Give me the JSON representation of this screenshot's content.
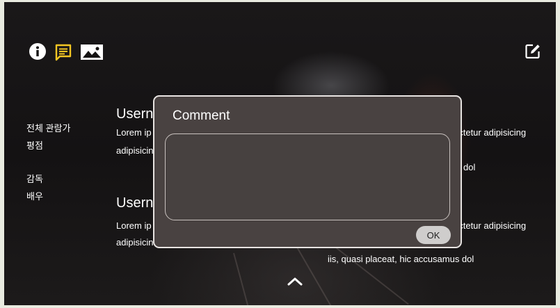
{
  "toolbar": {
    "info_icon": "info-icon",
    "comment_icon": "comment-icon",
    "image_icon": "image-icon",
    "edit_icon": "edit-icon",
    "active_color": "#f3c623"
  },
  "sidebar": {
    "age_rating_label": "전체 관람가",
    "rating_label": "평점",
    "director_label": "감독",
    "actor_label": "배우"
  },
  "reviews": [
    {
      "username": "Usern",
      "left_line1": "Lorem ip",
      "left_line2": "adipisicin",
      "right_line1": "ectetur adipisicing",
      "right_line2": "dol"
    },
    {
      "username": "Usern",
      "left_line1": "Lorem ip",
      "left_line2": "adipisicin",
      "right_line1": "ectetur adipisicing",
      "right_line2": "iis, quasi placeat, hic accusamus dol"
    }
  ],
  "comment_modal": {
    "title": "Comment",
    "input_value": "",
    "ok_label": "OK"
  },
  "scroll_up_icon": "chevron-up-icon"
}
